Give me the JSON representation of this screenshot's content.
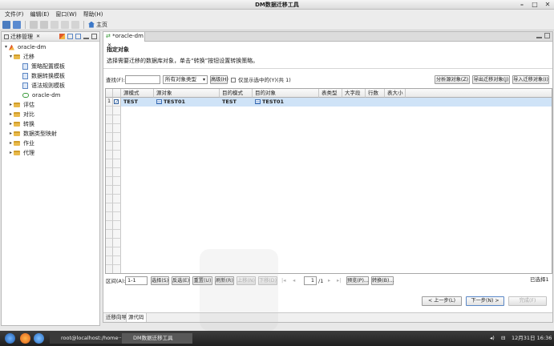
{
  "window": {
    "title": "DM数据迁移工具"
  },
  "menu": [
    "文件(F)",
    "编辑(E)",
    "窗口(W)",
    "帮助(H)"
  ],
  "toolbar": {
    "home_label": "主页"
  },
  "left_panel": {
    "title": "迁移管理",
    "tree": [
      {
        "label": "oracle-dm",
        "level": 0,
        "icon": "project-icon",
        "expanded": true
      },
      {
        "label": "迁移",
        "level": 1,
        "icon": "folder-icon",
        "expanded": true
      },
      {
        "label": "策略配置模板",
        "level": 2,
        "icon": "template-icon"
      },
      {
        "label": "数据转换模板",
        "level": 2,
        "icon": "template-icon"
      },
      {
        "label": "语法规则模板",
        "level": 2,
        "icon": "template-icon"
      },
      {
        "label": "oracle-dm",
        "level": 2,
        "icon": "migration-icon"
      },
      {
        "label": "评估",
        "level": 1,
        "icon": "folder-icon"
      },
      {
        "label": "对比",
        "level": 1,
        "icon": "folder-icon"
      },
      {
        "label": "转换",
        "level": 1,
        "icon": "folder-icon"
      },
      {
        "label": "数据类型映射",
        "level": 1,
        "icon": "folder-icon"
      },
      {
        "label": "作业",
        "level": 1,
        "icon": "folder-icon"
      },
      {
        "label": "代理",
        "level": 1,
        "icon": "folder-icon"
      }
    ]
  },
  "editor": {
    "tab_label": "*oracle-dm",
    "section_title": "指定对象",
    "description": "选择需要迁移的数据库对象，单击“转换”按钮设置转换策略。",
    "search": {
      "label": "查找(F):",
      "value": "",
      "type_select": "所有对象类型",
      "advanced_button": "高级(H)",
      "show_selected_label": "仅显示选中的(Y)",
      "count_text": "(共 1)"
    },
    "action_buttons": [
      "分析源对象(Z)",
      "导出迁移对象(J)",
      "导入迁移对象(I)"
    ],
    "grid": {
      "columns": [
        "源模式",
        "源对象",
        "目的模式",
        "目的对象",
        "表类型",
        "大字段",
        "行数",
        "表大小"
      ],
      "rows": [
        {
          "num": "1",
          "checked": true,
          "cells": [
            "TEST",
            "TEST01",
            "TEST",
            "TEST01",
            "",
            "",
            "",
            ""
          ]
        }
      ]
    },
    "range": {
      "label": "区间(A):",
      "value": "1-1",
      "buttons": [
        "选择(S)",
        "反选(E)",
        "重置(U)",
        "刷新(R)",
        "上移(N)",
        "下移(D)"
      ],
      "page_value": "1",
      "page_total": "/1",
      "preview_button": "预览(P)...",
      "convert_button": "转换(B)...",
      "selected_text": "已选择1"
    },
    "nav_buttons": {
      "prev": "< 上一步(L)",
      "next": "下一步(N) >",
      "finish": "完成(F)"
    },
    "bottom_tabs": [
      "迁移向导",
      "源代码"
    ]
  },
  "taskbar": {
    "tasks": [
      "root@localhost:/home···",
      "DM数据迁移工具"
    ],
    "clock": "12月31日 16:36"
  }
}
